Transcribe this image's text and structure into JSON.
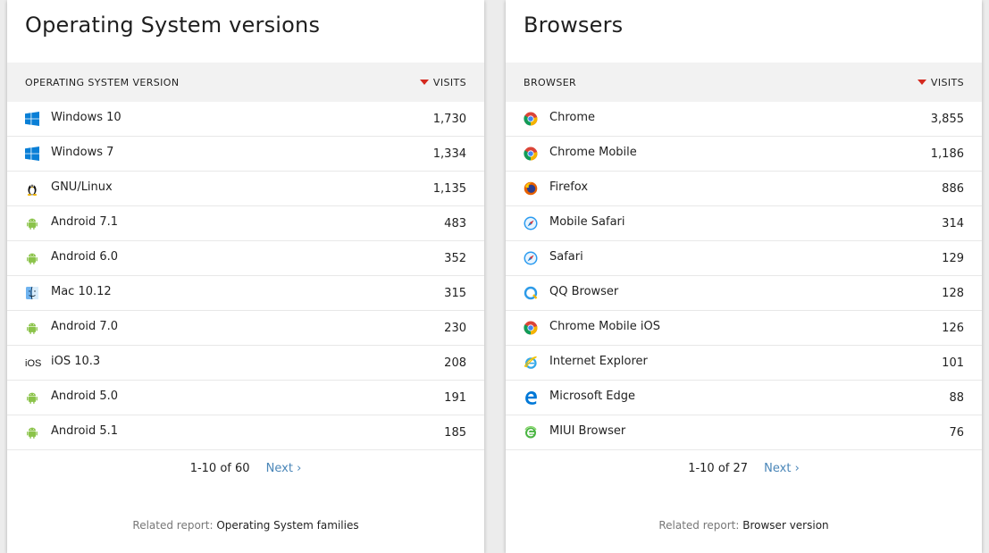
{
  "os": {
    "title": "Operating System versions",
    "col_label": "OPERATING SYSTEM VERSION",
    "col_visits": "VISITS",
    "rows": [
      {
        "label": "Windows 10",
        "visits": "1,730",
        "icon": "windows-icon"
      },
      {
        "label": "Windows 7",
        "visits": "1,334",
        "icon": "windows-icon"
      },
      {
        "label": "GNU/Linux",
        "visits": "1,135",
        "icon": "linux-icon"
      },
      {
        "label": "Android 7.1",
        "visits": "483",
        "icon": "android-icon"
      },
      {
        "label": "Android 6.0",
        "visits": "352",
        "icon": "android-icon"
      },
      {
        "label": "Mac 10.12",
        "visits": "315",
        "icon": "mac-icon"
      },
      {
        "label": "Android 7.0",
        "visits": "230",
        "icon": "android-icon"
      },
      {
        "label": "iOS 10.3",
        "visits": "208",
        "icon": "ios-icon"
      },
      {
        "label": "Android 5.0",
        "visits": "191",
        "icon": "android-icon"
      },
      {
        "label": "Android 5.1",
        "visits": "185",
        "icon": "android-icon"
      }
    ],
    "pagination": "1-10 of 60",
    "next": "Next ›",
    "related_prefix": "Related report: ",
    "related_link": "Operating System families"
  },
  "browsers": {
    "title": "Browsers",
    "col_label": "BROWSER",
    "col_visits": "VISITS",
    "rows": [
      {
        "label": "Chrome",
        "visits": "3,855",
        "icon": "chrome-icon"
      },
      {
        "label": "Chrome Mobile",
        "visits": "1,186",
        "icon": "chrome-icon"
      },
      {
        "label": "Firefox",
        "visits": "886",
        "icon": "firefox-icon"
      },
      {
        "label": "Mobile Safari",
        "visits": "314",
        "icon": "safari-icon"
      },
      {
        "label": "Safari",
        "visits": "129",
        "icon": "safari-icon"
      },
      {
        "label": "QQ Browser",
        "visits": "128",
        "icon": "qq-browser-icon"
      },
      {
        "label": "Chrome Mobile iOS",
        "visits": "126",
        "icon": "chrome-icon"
      },
      {
        "label": "Internet Explorer",
        "visits": "101",
        "icon": "internet-explorer-icon"
      },
      {
        "label": "Microsoft Edge",
        "visits": "88",
        "icon": "edge-icon"
      },
      {
        "label": "MIUI Browser",
        "visits": "76",
        "icon": "miui-browser-icon"
      }
    ],
    "pagination": "1-10 of 27",
    "next": "Next ›",
    "related_prefix": "Related report: ",
    "related_link": "Browser version"
  },
  "colors": {
    "sort_arrow": "#d4291f",
    "link": "#4a86b8",
    "header_bg": "#f2f2f2"
  }
}
